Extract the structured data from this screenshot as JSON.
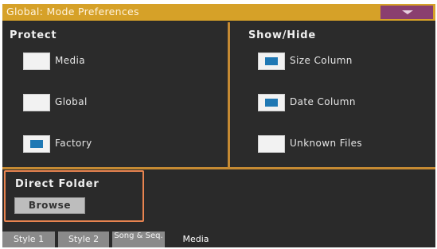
{
  "window": {
    "title": "Global: Mode Preferences"
  },
  "protect": {
    "title": "Protect",
    "items": [
      {
        "label": "Media",
        "checked": false
      },
      {
        "label": "Global",
        "checked": false
      },
      {
        "label": "Factory",
        "checked": true
      }
    ]
  },
  "show_hide": {
    "title": "Show/Hide",
    "items": [
      {
        "label": "Size Column",
        "checked": true
      },
      {
        "label": "Date Column",
        "checked": true
      },
      {
        "label": "Unknown Files",
        "checked": false
      }
    ]
  },
  "direct_folder": {
    "title": "Direct Folder",
    "browse_label": "Browse"
  },
  "tabs": [
    {
      "label": "Style 1",
      "active": false
    },
    {
      "label": "Style 2",
      "active": false
    },
    {
      "label": "Song & Seq.",
      "active": false
    },
    {
      "label": "Media",
      "active": true
    }
  ],
  "colors": {
    "title_bar": "#d6a128",
    "menu_button": "#8a3f6f",
    "divider": "#c58a33",
    "highlight_border": "#e88450",
    "checkbox_mark": "#1f78b4"
  }
}
